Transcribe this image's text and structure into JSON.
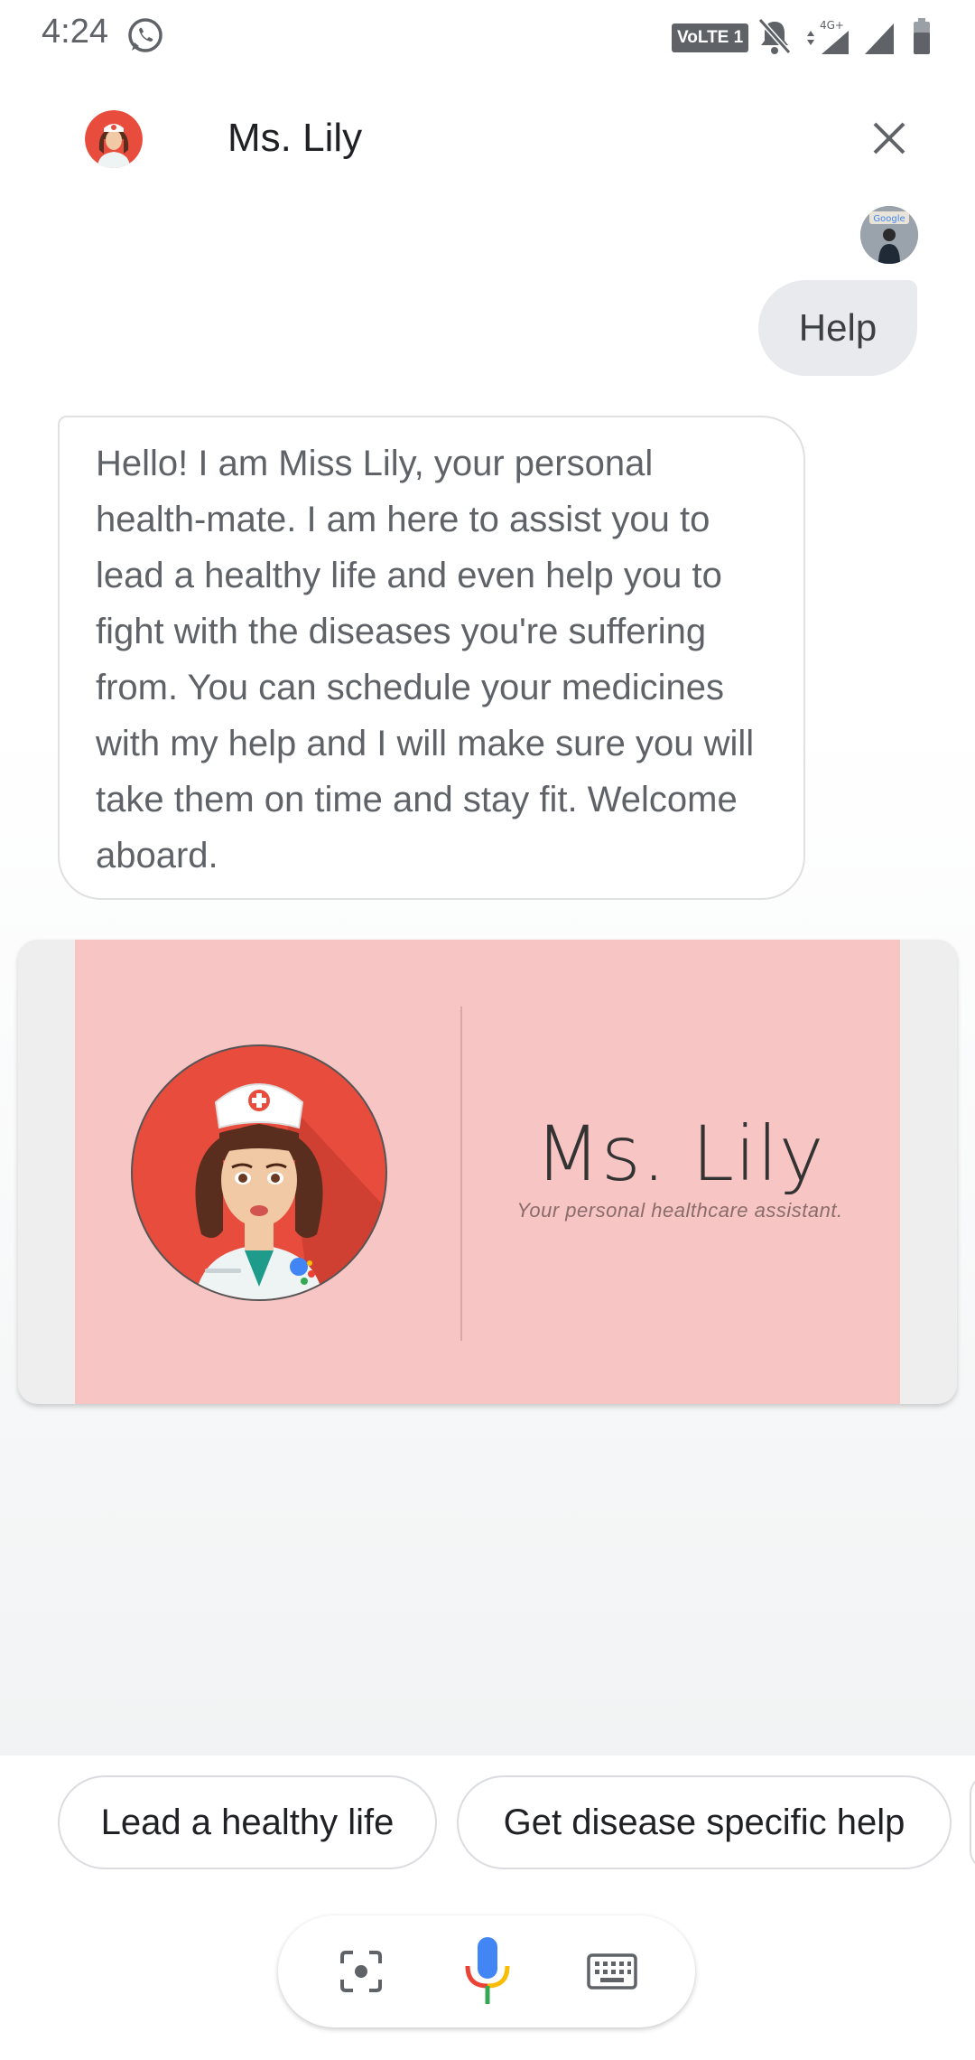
{
  "status_bar": {
    "time": "4:24",
    "network_badge": "VoLTE 1",
    "icons": [
      "whatsapp-icon",
      "volte-icon",
      "bell-off-icon",
      "data-4g-icon",
      "signal-icon",
      "signal-icon",
      "battery-icon"
    ],
    "data_label": "4G+"
  },
  "header": {
    "title": "Ms. Lily",
    "close_icon": "close-icon"
  },
  "conversation": {
    "user_message": "Help",
    "bot_message": "Hello! I am Miss Lily, your personal health-mate. I am here to assist you to lead a healthy life and even help you to fight with the diseases you're suffering from. You can schedule your medicines with my help and I will make sure you will take them on time and stay fit. Welcome aboard.",
    "user_avatar_label": "Google"
  },
  "card": {
    "title": "Ms. Lily",
    "subtitle": "Your personal healthcare assistant."
  },
  "suggestions": [
    {
      "label": "Lead a healthy life"
    },
    {
      "label": "Get disease specific help"
    }
  ],
  "input_bar": {
    "icons": [
      "lens-icon",
      "microphone-icon",
      "keyboard-icon"
    ]
  },
  "colors": {
    "card_background": "#f7c5c3",
    "nurse_circle": "#e84c3d",
    "mic_blue": "#4285f4",
    "mic_red": "#ea4335",
    "mic_yellow": "#fbbc05",
    "mic_green": "#34a853"
  }
}
